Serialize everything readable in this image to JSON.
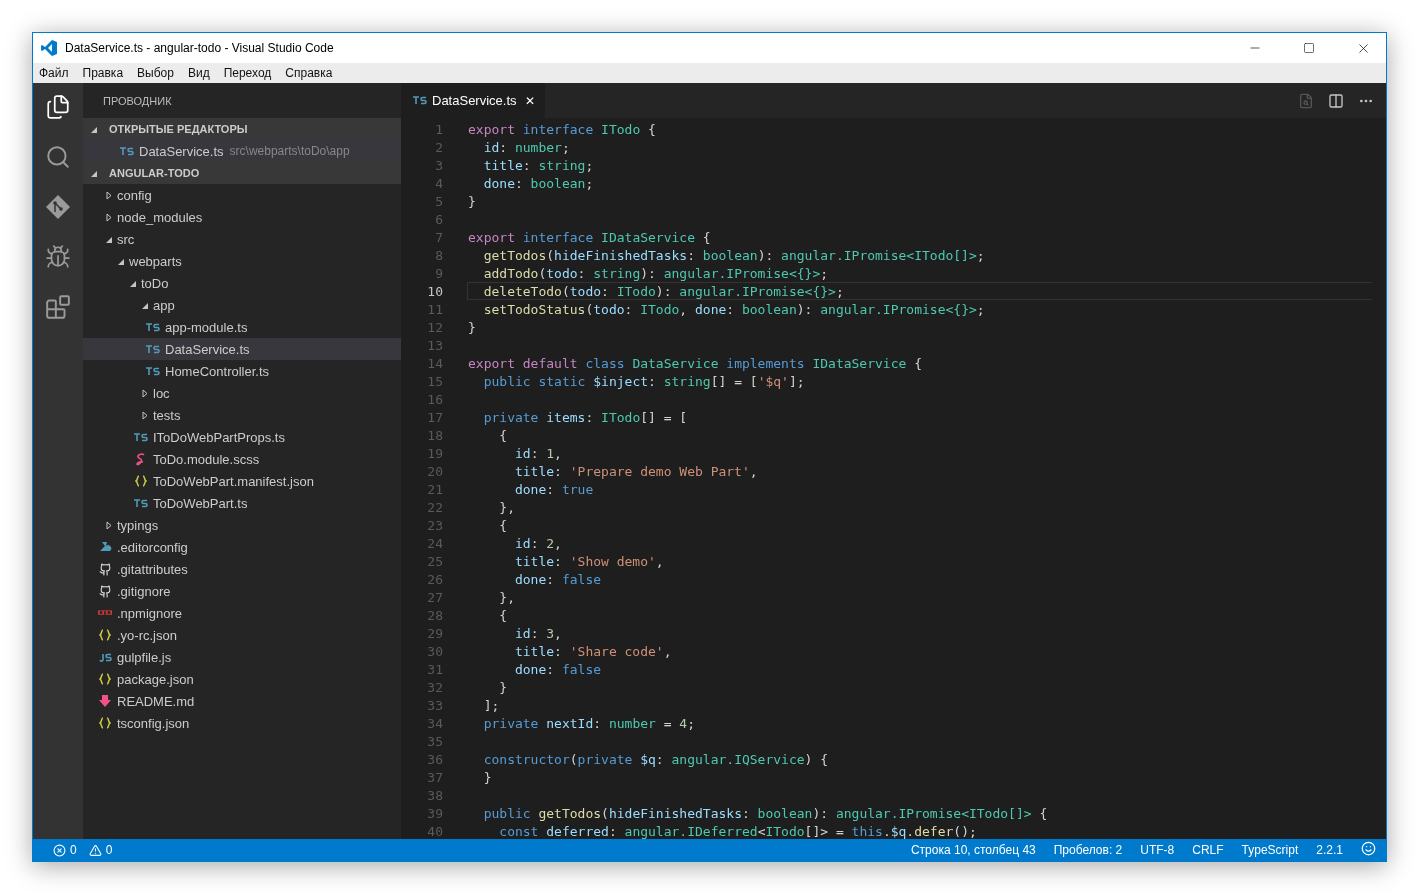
{
  "window": {
    "title": "DataService.ts - angular-todo - Visual Studio Code"
  },
  "menu": [
    "Файл",
    "Правка",
    "Выбор",
    "Вид",
    "Переход",
    "Справка"
  ],
  "activity_bar": [
    {
      "kind": "files",
      "selected": true
    },
    {
      "kind": "search",
      "selected": false
    },
    {
      "kind": "git",
      "selected": false
    },
    {
      "kind": "debug",
      "selected": false
    },
    {
      "kind": "extensions",
      "selected": false
    }
  ],
  "sidebar": {
    "title": "ПРОВОДНИК",
    "open_editors": {
      "title": "ОТКРЫТЫЕ РЕДАКТОРЫ",
      "expanded": true,
      "items": [
        {
          "kind": "ts",
          "name": "DataService.ts",
          "path": "src\\webparts\\toDo\\app",
          "selected": true
        }
      ]
    },
    "project": {
      "title": "ANGULAR-TODO",
      "expanded": true,
      "items": [
        {
          "kind": "folder",
          "name": "config",
          "expanded": false,
          "selected": false
        },
        {
          "kind": "folder",
          "name": "node_modules",
          "expanded": false,
          "selected": false
        },
        {
          "kind": "folder",
          "name": "src",
          "expanded": true,
          "selected": false,
          "children": [
            {
              "kind": "folder",
              "name": "webparts",
              "expanded": true,
              "selected": false,
              "children": [
                {
                  "kind": "folder",
                  "name": "toDo",
                  "expanded": true,
                  "selected": false,
                  "children": [
                    {
                      "kind": "folder",
                      "name": "app",
                      "expanded": true,
                      "selected": false,
                      "children": [
                        {
                          "kind": "ts",
                          "name": "app-module.ts",
                          "selected": false
                        },
                        {
                          "kind": "ts",
                          "name": "DataService.ts",
                          "selected": true
                        },
                        {
                          "kind": "ts",
                          "name": "HomeController.ts",
                          "selected": false
                        }
                      ]
                    },
                    {
                      "kind": "folder",
                      "name": "loc",
                      "expanded": false,
                      "selected": false
                    },
                    {
                      "kind": "folder",
                      "name": "tests",
                      "expanded": false,
                      "selected": false
                    },
                    {
                      "kind": "ts",
                      "name": "IToDoWebPartProps.ts",
                      "selected": false
                    },
                    {
                      "kind": "scss",
                      "name": "ToDo.module.scss",
                      "selected": false
                    },
                    {
                      "kind": "json",
                      "name": "ToDoWebPart.manifest.json",
                      "selected": false
                    },
                    {
                      "kind": "ts",
                      "name": "ToDoWebPart.ts",
                      "selected": false
                    }
                  ]
                }
              ]
            }
          ]
        },
        {
          "kind": "folder",
          "name": "typings",
          "expanded": false,
          "selected": false
        },
        {
          "kind": "editorconfig",
          "name": ".editorconfig",
          "selected": false
        },
        {
          "kind": "git",
          "name": ".gitattributes",
          "selected": false
        },
        {
          "kind": "git",
          "name": ".gitignore",
          "selected": false
        },
        {
          "kind": "npm",
          "name": ".npmignore",
          "selected": false
        },
        {
          "kind": "json",
          "name": ".yo-rc.json",
          "selected": false
        },
        {
          "kind": "js",
          "name": "gulpfile.js",
          "selected": false
        },
        {
          "kind": "json",
          "name": "package.json",
          "selected": false
        },
        {
          "kind": "readme",
          "name": "README.md",
          "selected": false
        },
        {
          "kind": "json",
          "name": "tsconfig.json",
          "selected": false
        }
      ]
    }
  },
  "tabs": [
    {
      "kind": "ts",
      "label": "DataService.ts",
      "selected": true,
      "close": "✕"
    }
  ],
  "editor": {
    "lines": [
      {
        "number": "1",
        "current": false,
        "tokens": [
          {
            "text": "export",
            "kind": "kw"
          },
          {
            "text": " interface",
            "kind": "st"
          },
          {
            "text": " ITodo",
            "kind": "ty"
          },
          {
            "text": " {",
            "kind": "p"
          }
        ]
      },
      {
        "number": "2",
        "current": false,
        "tokens": [
          {
            "text": "  id",
            "kind": "var"
          },
          {
            "text": ":",
            "kind": "p"
          },
          {
            "text": " number",
            "kind": "ty"
          },
          {
            "text": ";",
            "kind": "p"
          }
        ]
      },
      {
        "number": "3",
        "current": false,
        "tokens": [
          {
            "text": "  title",
            "kind": "var"
          },
          {
            "text": ":",
            "kind": "p"
          },
          {
            "text": " string",
            "kind": "ty"
          },
          {
            "text": ";",
            "kind": "p"
          }
        ]
      },
      {
        "number": "4",
        "current": false,
        "tokens": [
          {
            "text": "  done",
            "kind": "var"
          },
          {
            "text": ":",
            "kind": "p"
          },
          {
            "text": " boolean",
            "kind": "ty"
          },
          {
            "text": ";",
            "kind": "p"
          }
        ]
      },
      {
        "number": "5",
        "current": false,
        "tokens": [
          {
            "text": "}",
            "kind": "p"
          }
        ]
      },
      {
        "number": "6",
        "current": false
      },
      {
        "number": "7",
        "current": false,
        "tokens": [
          {
            "text": "export",
            "kind": "kw"
          },
          {
            "text": " interface",
            "kind": "st"
          },
          {
            "text": " IDataService",
            "kind": "ty"
          },
          {
            "text": " {",
            "kind": "p"
          }
        ]
      },
      {
        "number": "8",
        "current": false,
        "tokens": [
          {
            "text": "  getTodos",
            "kind": "fn"
          },
          {
            "text": "(",
            "kind": "p"
          },
          {
            "text": "hideFinishedTasks",
            "kind": "var"
          },
          {
            "text": ":",
            "kind": "p"
          },
          {
            "text": " boolean",
            "kind": "ty"
          },
          {
            "text": "): ",
            "kind": "p"
          },
          {
            "text": "angular.IPromise<ITodo[]>",
            "kind": "ty"
          },
          {
            "text": ";",
            "kind": "p"
          }
        ]
      },
      {
        "number": "9",
        "current": false,
        "tokens": [
          {
            "text": "  addTodo",
            "kind": "fn"
          },
          {
            "text": "(",
            "kind": "p"
          },
          {
            "text": "todo",
            "kind": "var"
          },
          {
            "text": ":",
            "kind": "p"
          },
          {
            "text": " string",
            "kind": "ty"
          },
          {
            "text": "): ",
            "kind": "p"
          },
          {
            "text": "angular.IPromise<{}>",
            "kind": "ty"
          },
          {
            "text": ";",
            "kind": "p"
          }
        ]
      },
      {
        "number": "10",
        "current": true,
        "tokens": [
          {
            "text": "  deleteTodo",
            "kind": "fn"
          },
          {
            "text": "(",
            "kind": "p"
          },
          {
            "text": "todo",
            "kind": "var"
          },
          {
            "text": ":",
            "kind": "p"
          },
          {
            "text": " ITodo",
            "kind": "ty"
          },
          {
            "text": "): ",
            "kind": "p"
          },
          {
            "text": "angular.IPromise<{}>",
            "kind": "ty"
          },
          {
            "text": ";",
            "kind": "p"
          }
        ]
      },
      {
        "number": "11",
        "current": false,
        "tokens": [
          {
            "text": "  setTodoStatus",
            "kind": "fn"
          },
          {
            "text": "(",
            "kind": "p"
          },
          {
            "text": "todo",
            "kind": "var"
          },
          {
            "text": ":",
            "kind": "p"
          },
          {
            "text": " ITodo",
            "kind": "ty"
          },
          {
            "text": ", ",
            "kind": "p"
          },
          {
            "text": "done",
            "kind": "var"
          },
          {
            "text": ":",
            "kind": "p"
          },
          {
            "text": " boolean",
            "kind": "ty"
          },
          {
            "text": "): ",
            "kind": "p"
          },
          {
            "text": "angular.IPromise<{}>",
            "kind": "ty"
          },
          {
            "text": ";",
            "kind": "p"
          }
        ]
      },
      {
        "number": "12",
        "current": false,
        "tokens": [
          {
            "text": "}",
            "kind": "p"
          }
        ]
      },
      {
        "number": "13",
        "current": false
      },
      {
        "number": "14",
        "current": false,
        "tokens": [
          {
            "text": "export",
            "kind": "kw"
          },
          {
            "text": " default",
            "kind": "kw"
          },
          {
            "text": " class",
            "kind": "st"
          },
          {
            "text": " DataService",
            "kind": "ty"
          },
          {
            "text": " implements",
            "kind": "st"
          },
          {
            "text": " IDataService",
            "kind": "ty"
          },
          {
            "text": " {",
            "kind": "p"
          }
        ]
      },
      {
        "number": "15",
        "current": false,
        "tokens": [
          {
            "text": "  public",
            "kind": "st"
          },
          {
            "text": " static",
            "kind": "st"
          },
          {
            "text": " $inject",
            "kind": "var"
          },
          {
            "text": ":",
            "kind": "p"
          },
          {
            "text": " string",
            "kind": "ty"
          },
          {
            "text": "[] = [",
            "kind": "p"
          },
          {
            "text": "'$q'",
            "kind": "str"
          },
          {
            "text": "];",
            "kind": "p"
          }
        ]
      },
      {
        "number": "16",
        "current": false
      },
      {
        "number": "17",
        "current": false,
        "tokens": [
          {
            "text": "  private",
            "kind": "st"
          },
          {
            "text": " items",
            "kind": "var"
          },
          {
            "text": ":",
            "kind": "p"
          },
          {
            "text": " ITodo",
            "kind": "ty"
          },
          {
            "text": "[] = [",
            "kind": "p"
          }
        ]
      },
      {
        "number": "18",
        "current": false,
        "tokens": [
          {
            "text": "    {",
            "kind": "p"
          }
        ]
      },
      {
        "number": "19",
        "current": false,
        "tokens": [
          {
            "text": "      id",
            "kind": "var"
          },
          {
            "text": ": ",
            "kind": "p"
          },
          {
            "text": "1",
            "kind": "num"
          },
          {
            "text": ",",
            "kind": "p"
          }
        ]
      },
      {
        "number": "20",
        "current": false,
        "tokens": [
          {
            "text": "      title",
            "kind": "var"
          },
          {
            "text": ": ",
            "kind": "p"
          },
          {
            "text": "'Prepare demo Web Part'",
            "kind": "str"
          },
          {
            "text": ",",
            "kind": "p"
          }
        ]
      },
      {
        "number": "21",
        "current": false,
        "tokens": [
          {
            "text": "      done",
            "kind": "var"
          },
          {
            "text": ": ",
            "kind": "p"
          },
          {
            "text": "true",
            "kind": "st"
          }
        ]
      },
      {
        "number": "22",
        "current": false,
        "tokens": [
          {
            "text": "    },",
            "kind": "p"
          }
        ]
      },
      {
        "number": "23",
        "current": false,
        "tokens": [
          {
            "text": "    {",
            "kind": "p"
          }
        ]
      },
      {
        "number": "24",
        "current": false,
        "tokens": [
          {
            "text": "      id",
            "kind": "var"
          },
          {
            "text": ": ",
            "kind": "p"
          },
          {
            "text": "2",
            "kind": "num"
          },
          {
            "text": ",",
            "kind": "p"
          }
        ]
      },
      {
        "number": "25",
        "current": false,
        "tokens": [
          {
            "text": "      title",
            "kind": "var"
          },
          {
            "text": ": ",
            "kind": "p"
          },
          {
            "text": "'Show demo'",
            "kind": "str"
          },
          {
            "text": ",",
            "kind": "p"
          }
        ]
      },
      {
        "number": "26",
        "current": false,
        "tokens": [
          {
            "text": "      done",
            "kind": "var"
          },
          {
            "text": ": ",
            "kind": "p"
          },
          {
            "text": "false",
            "kind": "st"
          }
        ]
      },
      {
        "number": "27",
        "current": false,
        "tokens": [
          {
            "text": "    },",
            "kind": "p"
          }
        ]
      },
      {
        "number": "28",
        "current": false,
        "tokens": [
          {
            "text": "    {",
            "kind": "p"
          }
        ]
      },
      {
        "number": "29",
        "current": false,
        "tokens": [
          {
            "text": "      id",
            "kind": "var"
          },
          {
            "text": ": ",
            "kind": "p"
          },
          {
            "text": "3",
            "kind": "num"
          },
          {
            "text": ",",
            "kind": "p"
          }
        ]
      },
      {
        "number": "30",
        "current": false,
        "tokens": [
          {
            "text": "      title",
            "kind": "var"
          },
          {
            "text": ": ",
            "kind": "p"
          },
          {
            "text": "'Share code'",
            "kind": "str"
          },
          {
            "text": ",",
            "kind": "p"
          }
        ]
      },
      {
        "number": "31",
        "current": false,
        "tokens": [
          {
            "text": "      done",
            "kind": "var"
          },
          {
            "text": ": ",
            "kind": "p"
          },
          {
            "text": "false",
            "kind": "st"
          }
        ]
      },
      {
        "number": "32",
        "current": false,
        "tokens": [
          {
            "text": "    }",
            "kind": "p"
          }
        ]
      },
      {
        "number": "33",
        "current": false,
        "tokens": [
          {
            "text": "  ];",
            "kind": "p"
          }
        ]
      },
      {
        "number": "34",
        "current": false,
        "tokens": [
          {
            "text": "  private",
            "kind": "st"
          },
          {
            "text": " nextId",
            "kind": "var"
          },
          {
            "text": ":",
            "kind": "p"
          },
          {
            "text": " number",
            "kind": "ty"
          },
          {
            "text": " = ",
            "kind": "p"
          },
          {
            "text": "4",
            "kind": "num"
          },
          {
            "text": ";",
            "kind": "p"
          }
        ]
      },
      {
        "number": "35",
        "current": false
      },
      {
        "number": "36",
        "current": false,
        "tokens": [
          {
            "text": "  constructor",
            "kind": "st"
          },
          {
            "text": "(",
            "kind": "p"
          },
          {
            "text": "private",
            "kind": "st"
          },
          {
            "text": " $q",
            "kind": "var"
          },
          {
            "text": ":",
            "kind": "p"
          },
          {
            "text": " angular.IQService",
            "kind": "ty"
          },
          {
            "text": ") {",
            "kind": "p"
          }
        ]
      },
      {
        "number": "37",
        "current": false,
        "tokens": [
          {
            "text": "  }",
            "kind": "p"
          }
        ]
      },
      {
        "number": "38",
        "current": false
      },
      {
        "number": "39",
        "current": false,
        "tokens": [
          {
            "text": "  public",
            "kind": "st"
          },
          {
            "text": " getTodos",
            "kind": "fn"
          },
          {
            "text": "(",
            "kind": "p"
          },
          {
            "text": "hideFinishedTasks",
            "kind": "var"
          },
          {
            "text": ":",
            "kind": "p"
          },
          {
            "text": " boolean",
            "kind": "ty"
          },
          {
            "text": "): ",
            "kind": "p"
          },
          {
            "text": "angular.IPromise<ITodo[]>",
            "kind": "ty"
          },
          {
            "text": " {",
            "kind": "p"
          }
        ]
      },
      {
        "number": "40",
        "current": false,
        "tokens": [
          {
            "text": "    const",
            "kind": "st"
          },
          {
            "text": " deferred",
            "kind": "var"
          },
          {
            "text": ":",
            "kind": "p"
          },
          {
            "text": " angular.IDeferred",
            "kind": "ty"
          },
          {
            "text": "<",
            "kind": "p"
          },
          {
            "text": "ITodo",
            "kind": "ty"
          },
          {
            "text": "[]> = ",
            "kind": "p"
          },
          {
            "text": "this",
            "kind": "st"
          },
          {
            "text": ".",
            "kind": "p"
          },
          {
            "text": "$q",
            "kind": "var"
          },
          {
            "text": ".",
            "kind": "p"
          },
          {
            "text": "defer",
            "kind": "fn"
          },
          {
            "text": "();",
            "kind": "p"
          }
        ]
      }
    ]
  },
  "status_bar": {
    "errors": "0",
    "warnings": "0",
    "items": [
      "Строка 10, столбец 43",
      "Пробелов: 2",
      "UTF-8",
      "CRLF",
      "TypeScript",
      "2.2.1"
    ]
  }
}
